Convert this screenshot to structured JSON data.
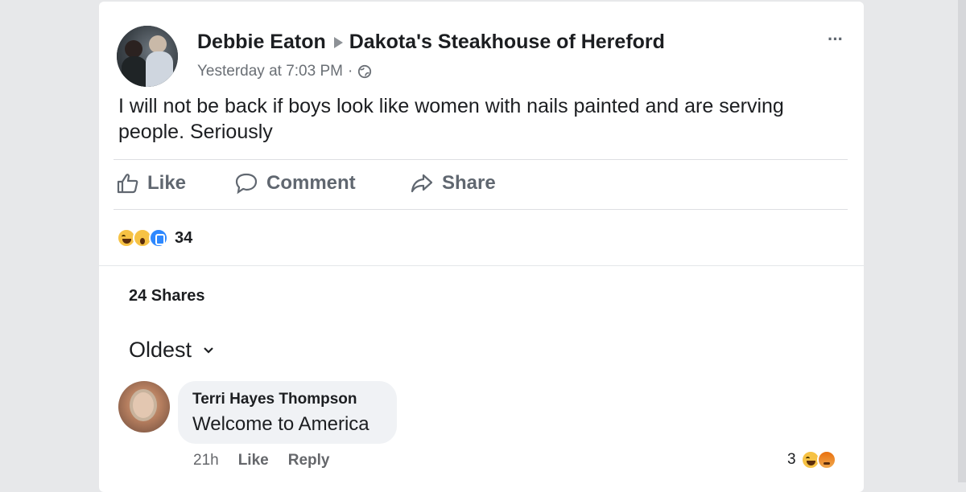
{
  "post": {
    "author": "Debbie Eaton",
    "page": "Dakota's Steakhouse of Hereford",
    "timestamp": "Yesterday at 7:03 PM",
    "separator": "·",
    "more": "···",
    "text": "I will not be back if boys look like women with nails painted and are serving people. Seriously"
  },
  "actions": {
    "like": "Like",
    "comment": "Comment",
    "share": "Share"
  },
  "reactions": {
    "icons": [
      "haha-emoji-icon",
      "wow-emoji-icon",
      "like-emoji-icon"
    ],
    "count": "34"
  },
  "shares": "24 Shares",
  "sort": {
    "label": "Oldest"
  },
  "comment": {
    "author": "Terri Hayes Thompson",
    "text": "Welcome to America",
    "time": "21h",
    "like": "Like",
    "reply": "Reply",
    "reaction_count": "3",
    "reaction_icons": [
      "haha-emoji-icon",
      "angry-emoji-icon"
    ]
  },
  "colors": {
    "background": "#e7e8ea",
    "card": "#ffffff",
    "text": "#1c1e21",
    "muted": "#606770",
    "bubble": "#f0f2f5",
    "like_blue": "#2d88ff"
  }
}
